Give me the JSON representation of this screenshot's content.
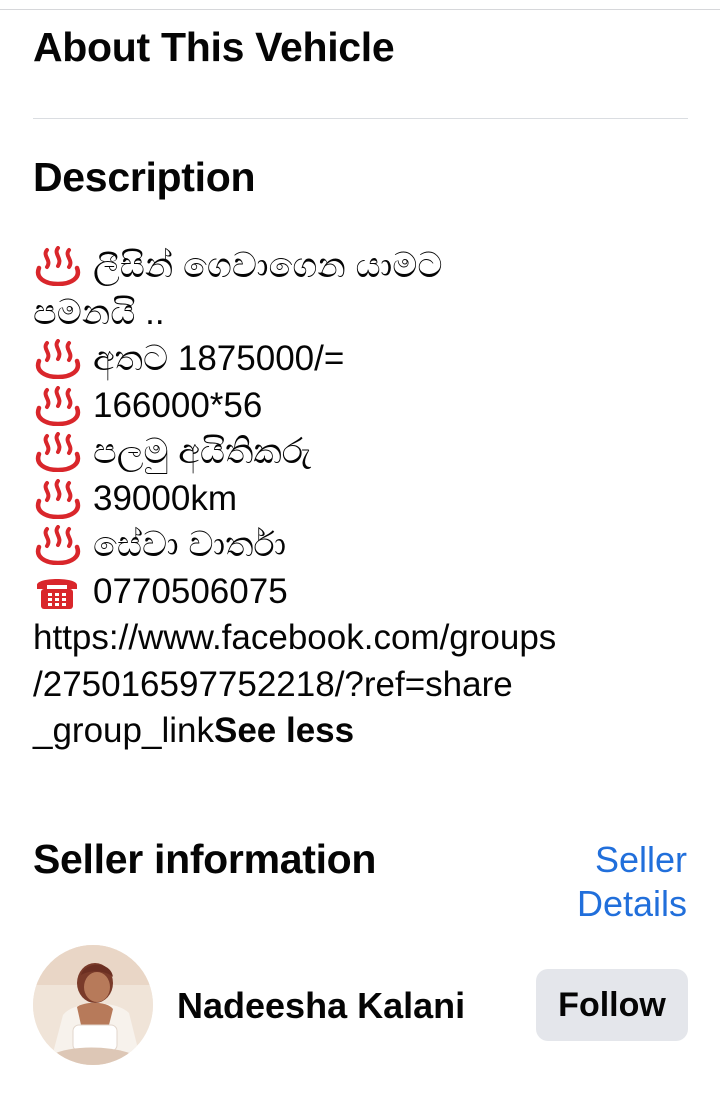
{
  "about": {
    "title": "About This Vehicle"
  },
  "description": {
    "title": "Description",
    "lines": [
      {
        "icon": "hot-springs-icon",
        "text": "ලීසින් ගෙවාගෙන යාමට"
      },
      {
        "icon": "",
        "text": "පමනයි .."
      },
      {
        "icon": "hot-springs-icon",
        "text": "අතට 1875000/="
      },
      {
        "icon": "hot-springs-icon",
        "text": "166000*56"
      },
      {
        "icon": "hot-springs-icon",
        "text": "පලමු අයිතිකරු"
      },
      {
        "icon": "hot-springs-icon",
        "text": "39000km"
      },
      {
        "icon": "hot-springs-icon",
        "text": "සේවා වාර්තා"
      },
      {
        "icon": "telephone-icon",
        "text": "0770506075"
      }
    ],
    "link_lines": [
      "https://www.facebook.com/groups",
      "/275016597752218/?ref=share",
      "_group_link"
    ],
    "see_less_label": "See less"
  },
  "seller": {
    "title": "Seller information",
    "details_link_line1": "Seller",
    "details_link_line2": "Details",
    "name": "Nadeesha Kalani",
    "follow_label": "Follow",
    "avatar_icon": "profile-photo"
  },
  "colors": {
    "link": "#216fdb",
    "hot_springs": "#d9262b",
    "follow_bg": "#e4e6eb",
    "divider": "#dadde1"
  }
}
